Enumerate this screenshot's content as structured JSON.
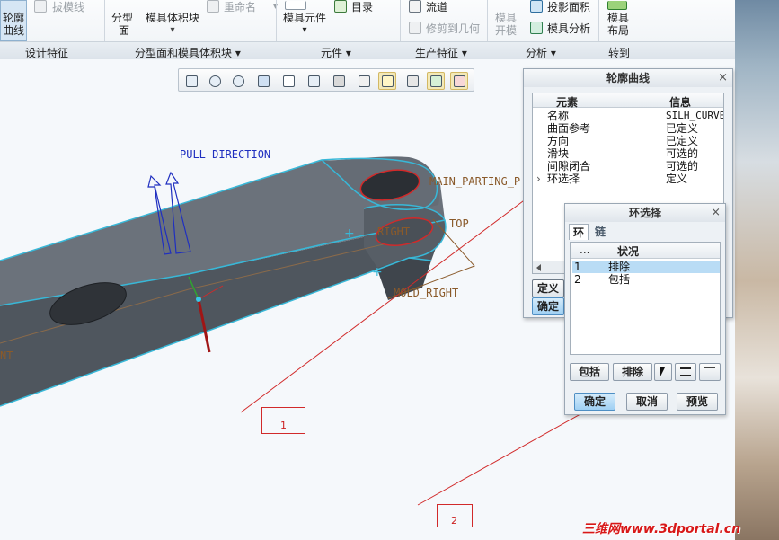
{
  "ribbon": {
    "silhouette_label_line1": "轮廓",
    "silhouette_label_line2": "曲线",
    "draft_line": "拔模线",
    "parting_surface_line1": "分型",
    "parting_surface_line2": "面",
    "mold_volume": "模具体积块",
    "rename": "重命名",
    "mold_component": "模具元件",
    "catalog": "目录",
    "runner": "流道",
    "trim_to_geometry": "修剪到几何",
    "mold_open_line1": "模具",
    "mold_open_line2": "开模",
    "projected_area": "投影面积",
    "mold_analysis": "模具分析",
    "mold_layout_line1": "模具",
    "mold_layout_line2": "布局",
    "groups": {
      "design_features": "设计特征",
      "parting_and_volume": "分型面和模具体积块",
      "components": "元件",
      "production_features": "生产特征",
      "analysis": "分析",
      "goto": "转到"
    },
    "dropdown_arrow": "▾"
  },
  "canvas": {
    "pull_direction_label": "PULL DIRECTION",
    "main_parting_label": "MAIN_PARTING_P",
    "right_label": "RIGHT",
    "top_label": "TOP",
    "mold_right_label": "MOLD_RIGHT",
    "left_edge_label": "NT"
  },
  "silhouette_dialog": {
    "title": "轮廓曲线",
    "close": "×",
    "col_element": "元素",
    "col_info": "信息",
    "rows": [
      {
        "element": "名称",
        "info": "SILH_CURVE_"
      },
      {
        "element": "曲面参考",
        "info": "已定义"
      },
      {
        "element": "方向",
        "info": "已定义"
      },
      {
        "element": "滑块",
        "info": "可选的"
      },
      {
        "element": "间隙闭合",
        "info": "可选的"
      },
      {
        "element": "环选择",
        "info": "定义"
      }
    ],
    "row_marker": "›",
    "define_button": "定义",
    "ok_button": "确定"
  },
  "loop_dialog": {
    "title": "环选择",
    "close": "×",
    "tab_loop": "环",
    "tab_chain": "链",
    "col_index": "...",
    "col_status": "状况",
    "rows": [
      {
        "index": "1",
        "status": "排除"
      },
      {
        "index": "2",
        "status": "包括"
      }
    ],
    "include_button": "包括",
    "exclude_button": "排除",
    "ok_button": "确定",
    "cancel_button": "取消",
    "preview_button": "预览"
  },
  "callouts": {
    "one": "1",
    "two": "2"
  },
  "watermark": "三维网www.3dportal.cn",
  "colors": {
    "model_body": "#4a5058",
    "model_top": "#6c737c",
    "edge_highlight": "#38b8d8",
    "annotation_red": "#d12a2a",
    "pull_arrow_blue": "#1f2fc0",
    "datum_text": "#8a5a2a",
    "selection_row": "#b9dcf5"
  }
}
